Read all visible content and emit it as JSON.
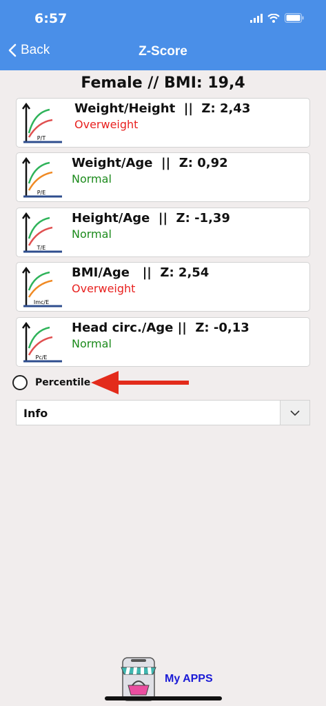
{
  "status_bar": {
    "time": "6:57"
  },
  "nav": {
    "back_label": "Back",
    "title": "Z-Score"
  },
  "subtitle": "Female // BMI: 19,4",
  "cards": [
    {
      "icon_label": "P/T",
      "title": "Weight/Height  ||  Z: 2,43",
      "status": "Overweight",
      "status_color": "#e8211f"
    },
    {
      "icon_label": "P/E",
      "title": "Weight/Age  ||  Z: 0,92",
      "status": "Normal",
      "status_color": "#1b8a1b"
    },
    {
      "icon_label": "T/E",
      "title": "Height/Age  ||  Z: -1,39",
      "status": "Normal",
      "status_color": "#1b8a1b"
    },
    {
      "icon_label": "Imc/E",
      "title": "BMI/Age   ||  Z: 2,54",
      "status": "Overweight",
      "status_color": "#e8211f"
    },
    {
      "icon_label": "Pc/E",
      "title": "Head circ./Age ||  Z: -0,13",
      "status": "Normal",
      "status_color": "#1b8a1b"
    }
  ],
  "percentile": {
    "label": "Percentile",
    "selected": false
  },
  "info": {
    "label": "Info"
  },
  "footer": {
    "myapps_label": "My APPS"
  },
  "colors": {
    "header": "#4a8fe8",
    "red": "#e8211f",
    "green": "#1b8a1b",
    "link": "#1a1ad6"
  }
}
